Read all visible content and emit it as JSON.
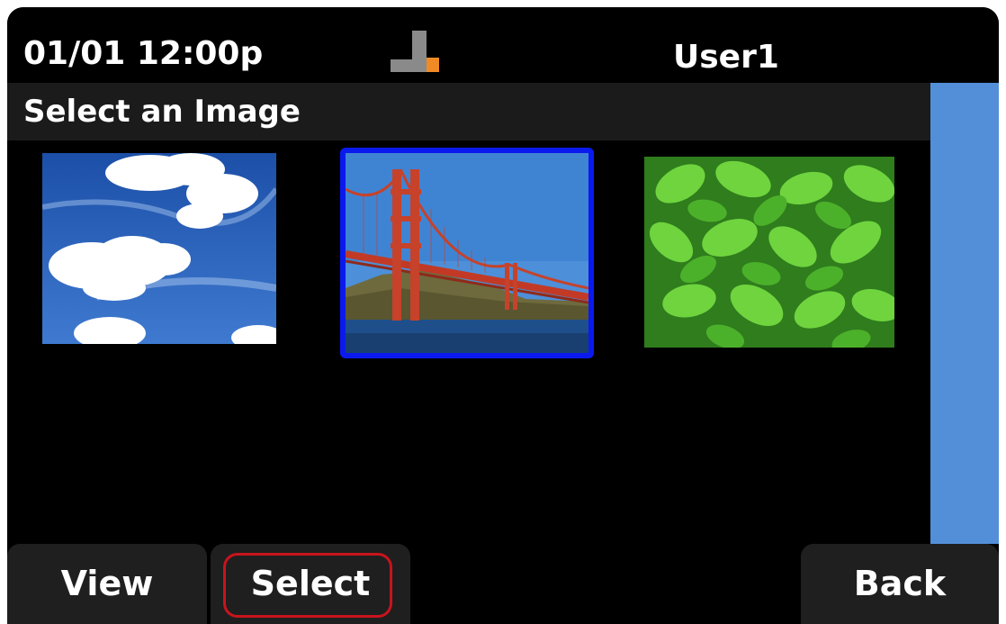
{
  "status_bar": {
    "datetime": "01/01 12:00p",
    "network_icon": "network-status-icon",
    "username": "User1"
  },
  "page": {
    "title": "Select an Image"
  },
  "gallery": {
    "images": [
      {
        "name": "sky-clouds-image",
        "selected": false
      },
      {
        "name": "golden-gate-bridge-image",
        "selected": true
      },
      {
        "name": "green-leaves-image",
        "selected": false
      }
    ]
  },
  "softkeys": {
    "view_label": "View",
    "select_label": "Select",
    "back_label": "Back"
  },
  "colors": {
    "background": "#000000",
    "title_bar": "#1b1b1b",
    "scrollbar": "#538fd9",
    "selection_border": "#0a1aee",
    "focus_ring": "#c8141c",
    "softkey_bg": "#1f1f1f",
    "network_accent": "#f08a24"
  }
}
